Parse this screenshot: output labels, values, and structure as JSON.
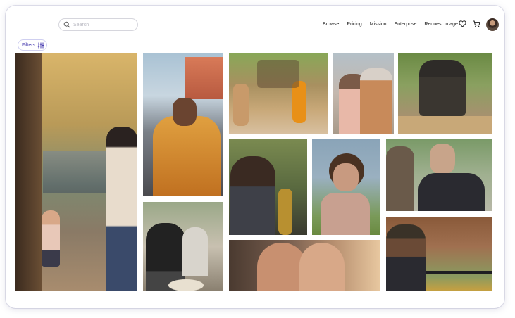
{
  "search": {
    "placeholder": "Search"
  },
  "nav": {
    "items": [
      "Browse",
      "Pricing",
      "Mission",
      "Enterprise",
      "Request Image"
    ]
  },
  "filters": {
    "label": "Filters"
  },
  "icons": {
    "search": "search-icon",
    "favorites": "heart-icon",
    "cart": "cart-icon",
    "filters": "sliders-icon",
    "avatar": "user-avatar"
  },
  "colors": {
    "accent": "#4b3fb0",
    "border": "#d6d6dd"
  },
  "photos": [
    {
      "subject": "street-toddler-autumn",
      "palette": [
        "#c9a25a",
        "#7a6a52",
        "#3d4a4a"
      ]
    },
    {
      "subject": "man-singing-microphone",
      "palette": [
        "#9db6c8",
        "#d4832c",
        "#3b3230"
      ]
    },
    {
      "subject": "dancers-outdoor-festival",
      "palette": [
        "#7d9a55",
        "#c9a070",
        "#e08a18"
      ]
    },
    {
      "subject": "couple-embracing",
      "palette": [
        "#a8b6c0",
        "#c9967a",
        "#7a5a48"
      ]
    },
    {
      "subject": "carpenter-working-wood",
      "palette": [
        "#5a7a3a",
        "#2e2b28",
        "#b89070"
      ]
    },
    {
      "subject": "saxophone-player",
      "palette": [
        "#6e7a4a",
        "#3a3228",
        "#a88a3a"
      ]
    },
    {
      "subject": "woman-curly-hair-city",
      "palette": [
        "#8aa0b4",
        "#6a8a4a",
        "#c89a80"
      ]
    },
    {
      "subject": "man-smiling-jacket",
      "palette": [
        "#7a9a6a",
        "#2a2a30",
        "#c8a48a"
      ]
    },
    {
      "subject": "women-dining-friends",
      "palette": [
        "#8a9a7a",
        "#2a2a2a",
        "#c8b8a8"
      ]
    },
    {
      "subject": "grandfather-hugging-child",
      "palette": [
        "#6a5040",
        "#c89070",
        "#e8c8a0"
      ]
    },
    {
      "subject": "security-guard-street",
      "palette": [
        "#8a5a3a",
        "#2a2a30",
        "#c8a040"
      ]
    }
  ]
}
